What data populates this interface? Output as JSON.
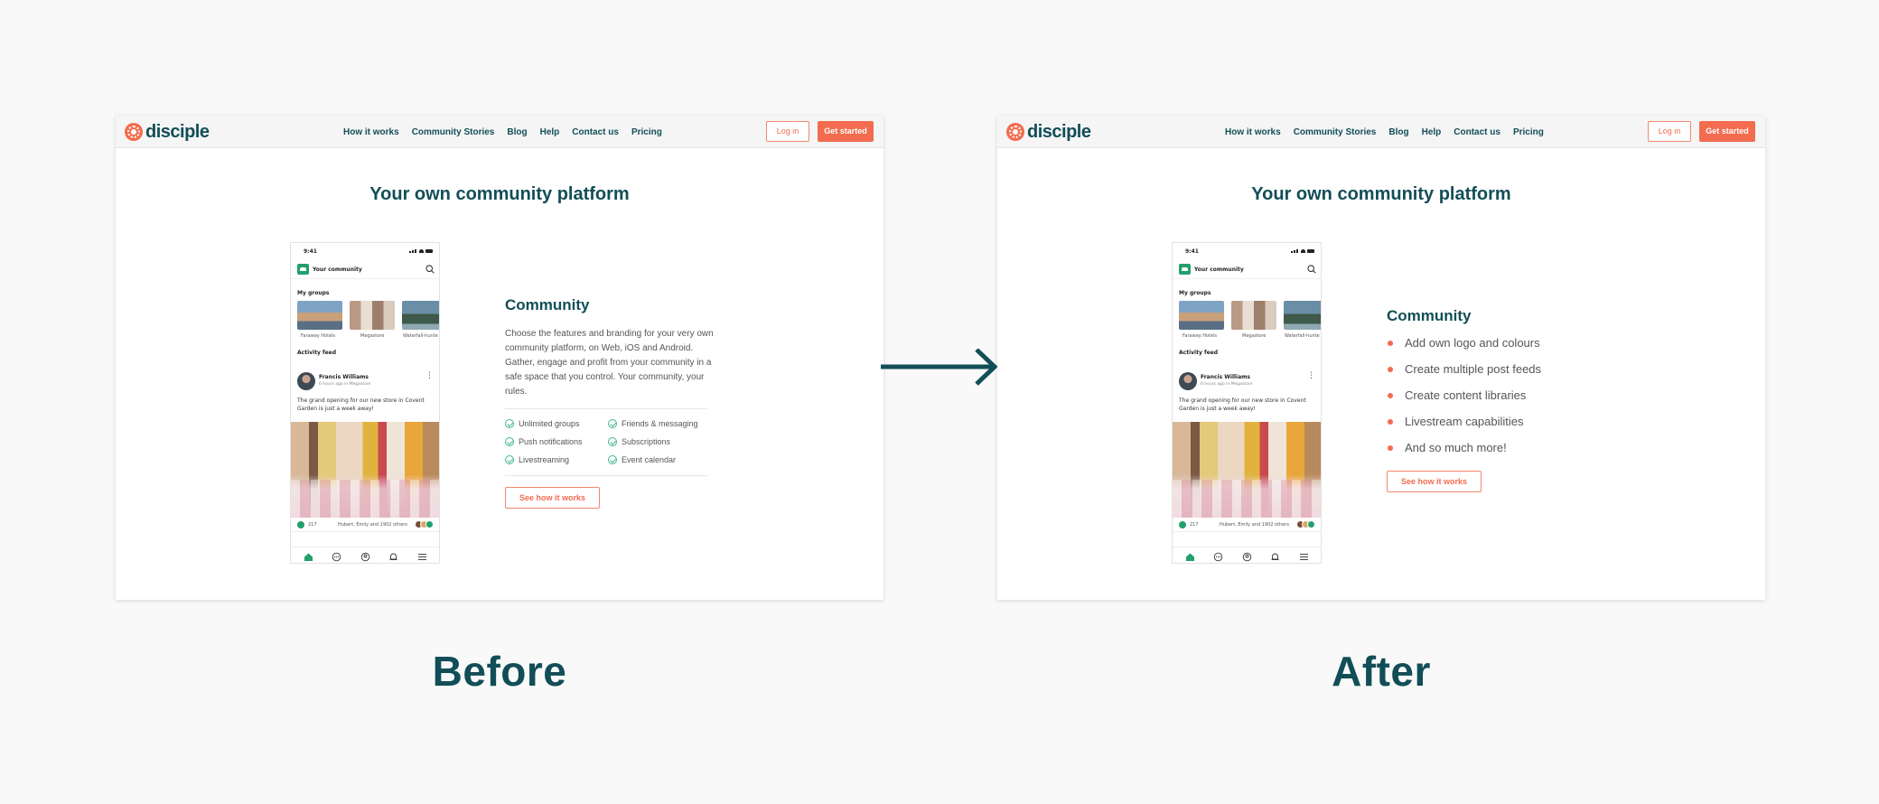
{
  "nav": {
    "brand": "disciple",
    "menu": [
      "How it works",
      "Community Stories",
      "Blog",
      "Help",
      "Contact us",
      "Pricing"
    ],
    "login": "Log in",
    "get_started": "Get started"
  },
  "headline": "Your own community platform",
  "phone": {
    "time": "9:41",
    "app_title": "Your community",
    "my_groups": "My groups",
    "groups": [
      "Faraway Hotels",
      "Megastore",
      "Waterfall-hunte"
    ],
    "activity_feed": "Activity feed",
    "post": {
      "author": "Francis Williams",
      "meta": "6 hours ago in Megastore",
      "text": "The grand opening for our new store in Covent Garden is just a week away!",
      "reaction_count": "217",
      "reactors": "Hubert, Emily and 1902 others"
    },
    "tab_icons": [
      "home-icon",
      "chat-icon",
      "profile-icon",
      "bell-icon",
      "menu-icon"
    ]
  },
  "before": {
    "title": "Community",
    "body": "Choose the features and branding for your very own community platform, on Web, iOS and Android. Gather, engage and profit from your community in a safe space that you control. Your community, your rules.",
    "features": [
      "Unlimited groups",
      "Push notifications",
      "Livestreaming",
      "Friends & messaging",
      "Subscriptions",
      "Event calendar"
    ],
    "cta": "See how it works"
  },
  "after": {
    "title": "Community",
    "bullets": [
      "Add own logo and colours",
      "Create multiple post feeds",
      "Create content libraries",
      "Livestream capabilities",
      "And so much more!"
    ],
    "cta": "See how it works"
  },
  "captions": {
    "before": "Before",
    "after": "After"
  },
  "colors": {
    "brand_teal": "#124e57",
    "brand_orange": "#f36c4f",
    "check_green": "#3fb887",
    "background": "#f9f9f9"
  }
}
